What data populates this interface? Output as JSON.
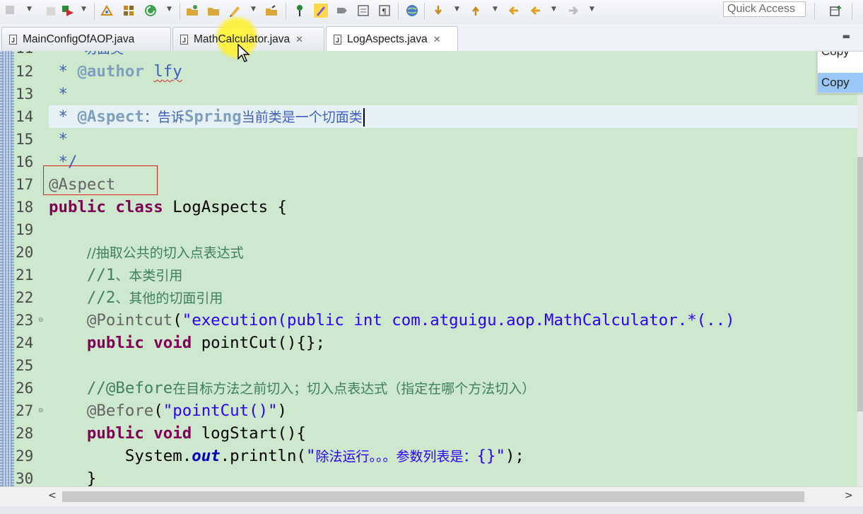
{
  "toolbar": {
    "quick_access_placeholder": "Quick Access",
    "icons": [
      "stop-icon",
      "debug-icon",
      "new-package-icon",
      "new-class-icon",
      "run-icon",
      "open-type-icon",
      "open-folder-icon",
      "edit-icon",
      "open-task-icon",
      "pin-icon",
      "highlight-icon",
      "format-icon",
      "toggle-icon",
      "paragraph-icon",
      "web-icon",
      "next-annotation-icon",
      "prev-annotation-icon",
      "back-icon",
      "forward-icon",
      "open-perspective-icon"
    ]
  },
  "tabs": [
    {
      "label": "MainConfigOfAOP.java",
      "active": false,
      "closable": false
    },
    {
      "label": "MathCalculator.java",
      "active": false,
      "closable": true
    },
    {
      "label": "LogAspects.java",
      "active": true,
      "closable": true
    }
  ],
  "popup": {
    "items": [
      "Copy",
      "Copy"
    ]
  },
  "editor": {
    "current_line": "14",
    "lines": [
      {
        "num": "12",
        "text": " * @author lfy"
      },
      {
        "num": "13",
        "text": " *"
      },
      {
        "num": "14",
        "text": " * @Aspect：告诉Spring当前类是一个切面类"
      },
      {
        "num": "15",
        "text": " *"
      },
      {
        "num": "16",
        "text": " */"
      },
      {
        "num": "17",
        "text": "@Aspect"
      },
      {
        "num": "18",
        "text": "public class LogAspects {"
      },
      {
        "num": "19",
        "text": ""
      },
      {
        "num": "20",
        "text": "    //抽取公共的切入点表达式"
      },
      {
        "num": "21",
        "text": "    //1、本类引用"
      },
      {
        "num": "22",
        "text": "    //2、其他的切面引用"
      },
      {
        "num": "23",
        "text": "    @Pointcut(\"execution(public int com.atguigu.aop.MathCalculator.*(..)"
      },
      {
        "num": "24",
        "text": "    public void pointCut(){};"
      },
      {
        "num": "25",
        "text": ""
      },
      {
        "num": "26",
        "text": "    //@Before在目标方法之前切入；切入点表达式（指定在哪个方法切入）"
      },
      {
        "num": "27",
        "text": "    @Before(\"pointCut()\")"
      },
      {
        "num": "28",
        "text": "    public void logStart(){"
      },
      {
        "num": "29",
        "text": "        System.out.println(\"除法运行。。。参数列表是：{}\");"
      },
      {
        "num": "30",
        "text": "    }"
      }
    ],
    "tokens": {
      "jd_star": " *",
      "jd_end": " */",
      "author_tag": "@author",
      "author_name": "lfy",
      "aspect_tag": "@Aspect",
      "line14_text_a": "：告诉",
      "line14_spring": "Spring",
      "line14_text_b": "当前类是一个切面类",
      "ann_aspect": "@Aspect",
      "kw_public": "public",
      "kw_class": "class",
      "class_name": " LogAspects {",
      "comment_20": "//抽取公共的切入点表达式",
      "comment_21_a": "//1",
      "comment_21_b": "、本类引用",
      "comment_22_a": "//2",
      "comment_22_b": "、其他的切面引用",
      "ann_pointcut": "@Pointcut",
      "pointcut_expr": "\"execution(public int com.atguigu.aop.MathCalculator.*(..)",
      "kw_void": "void",
      "pointcut_method": " pointCut(){};",
      "comment_26_a": "//@Before",
      "comment_26_b": "在目标方法之前切入；切入点表达式（指定在哪个方法切入）",
      "ann_before": "@Before",
      "before_arg": "\"pointCut()\"",
      "logstart_method": " logStart(){",
      "sys": "System.",
      "out": "out",
      "println": ".println(",
      "print_str_a": "\"",
      "print_str_cjk": "除法运行。。。参数列表是：",
      "print_str_b": "{}\"",
      "print_end": ");",
      "close_brace": "}",
      "paren_open": "(",
      "paren_close": ")",
      "top_partial": "切面类"
    }
  }
}
